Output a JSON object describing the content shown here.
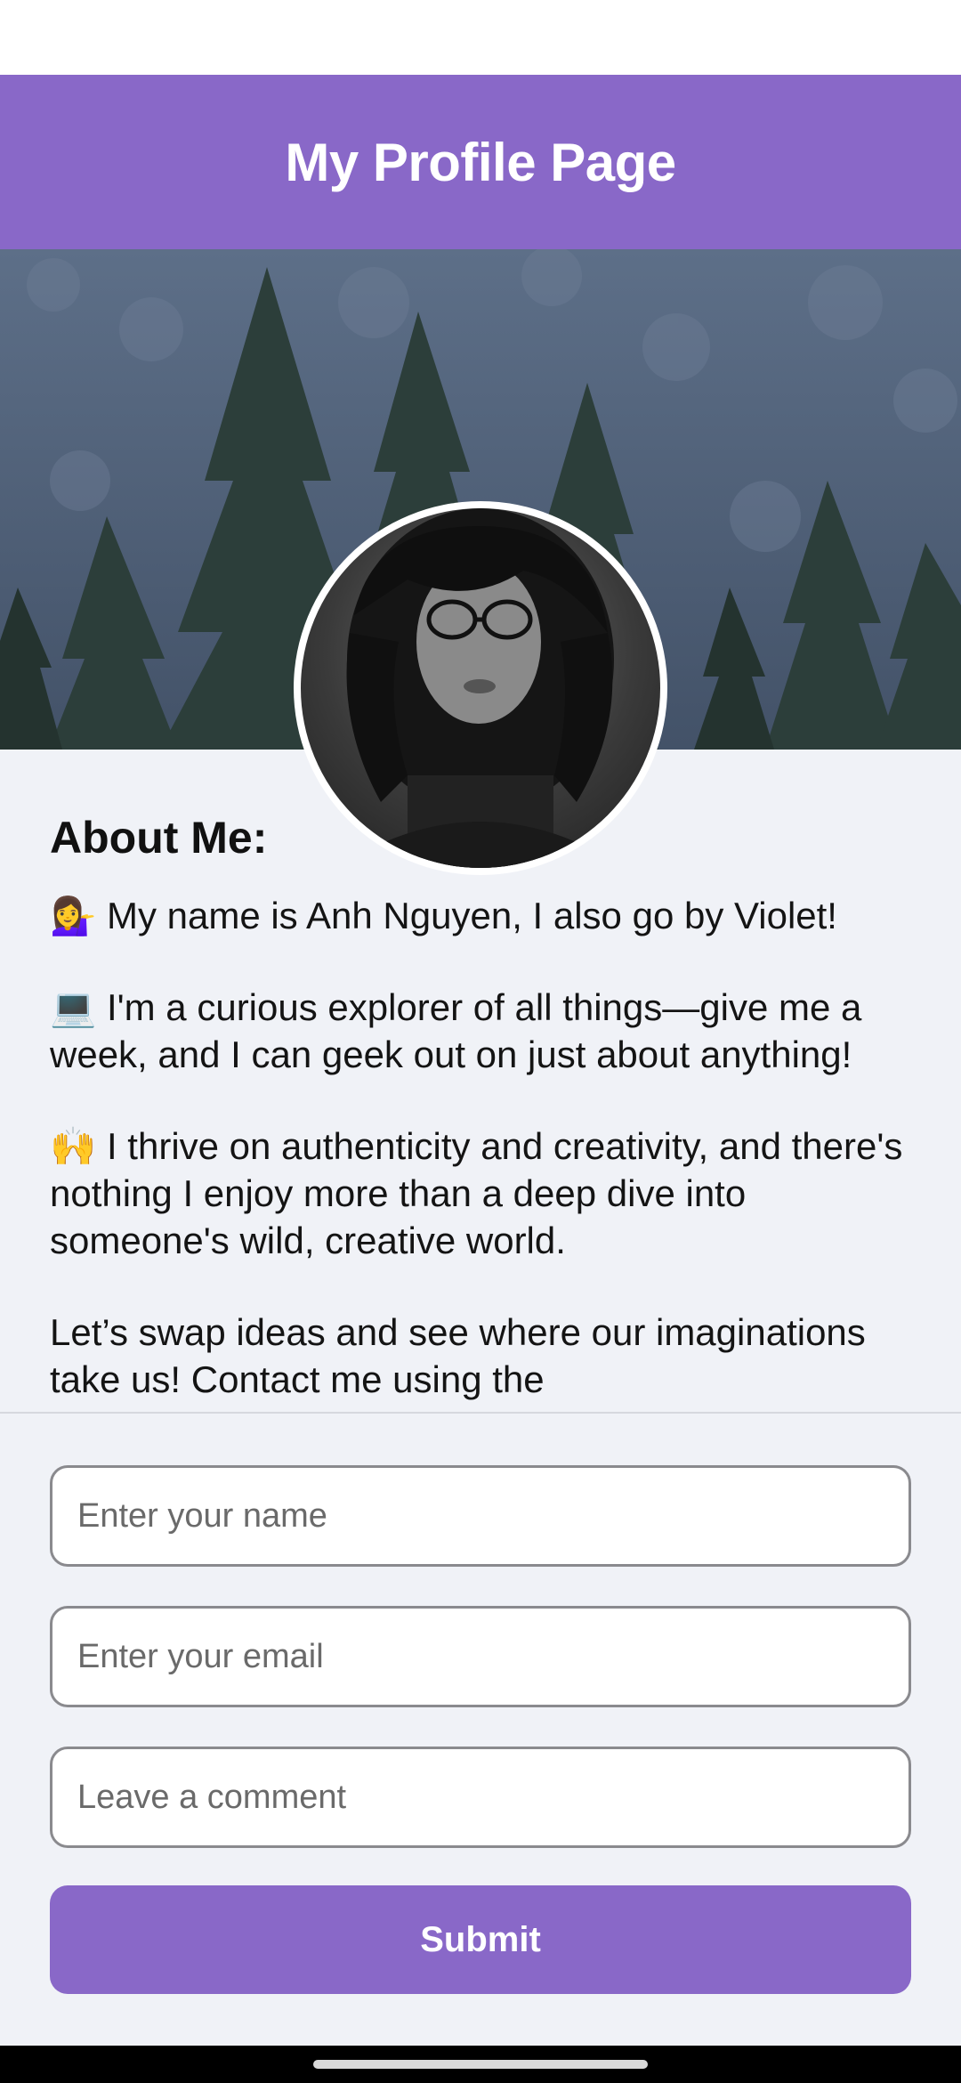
{
  "header": {
    "title": "My Profile Page"
  },
  "colors": {
    "accent": "#8968c8",
    "background": "#f0f2f7",
    "field_border": "#8a8a8e"
  },
  "profile": {
    "cover_image": "forest-cover-image",
    "avatar_image": "profile-avatar-image"
  },
  "about": {
    "heading": "About Me:",
    "paragraphs": [
      "💁‍♀️ My name is Anh Nguyen, I also go by Violet!",
      "💻 I'm a curious explorer of all things—give me a week, and I can geek out on just about anything!",
      "🙌 I thrive on authenticity and creativity, and there's nothing I enjoy more than a deep dive into someone's wild, creative world.",
      "Let’s swap ideas and see where our imaginations take us! Contact me using the"
    ]
  },
  "form": {
    "name_placeholder": "Enter your name",
    "email_placeholder": "Enter your email",
    "comment_placeholder": "Leave a comment",
    "submit_label": "Submit"
  }
}
